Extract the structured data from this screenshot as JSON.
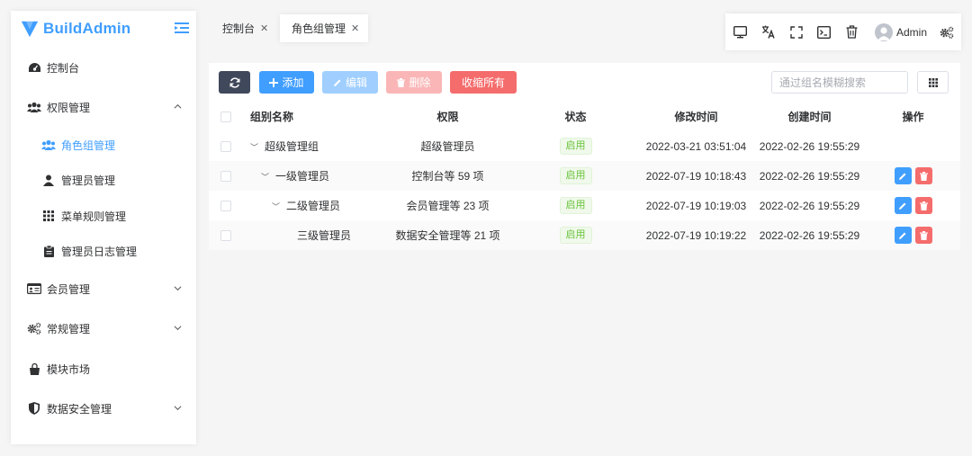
{
  "app": {
    "name": "BuildAdmin"
  },
  "sidebar": {
    "items": [
      {
        "label": "控制台"
      },
      {
        "label": "权限管理"
      },
      {
        "label": "角色组管理"
      },
      {
        "label": "管理员管理"
      },
      {
        "label": "菜单规则管理"
      },
      {
        "label": "管理员日志管理"
      },
      {
        "label": "会员管理"
      },
      {
        "label": "常规管理"
      },
      {
        "label": "模块市场"
      },
      {
        "label": "数据安全管理"
      }
    ]
  },
  "tabs": [
    {
      "label": "控制台"
    },
    {
      "label": "角色组管理"
    }
  ],
  "nav": {
    "username": "Admin"
  },
  "toolbar": {
    "add": "添加",
    "edit": "编辑",
    "delete": "删除",
    "collapse_all": "收缩所有",
    "search_placeholder": "通过组名模糊搜索"
  },
  "table": {
    "columns": [
      "组别名称",
      "权限",
      "状态",
      "修改时间",
      "创建时间",
      "操作"
    ],
    "rows": [
      {
        "name": "超级管理组",
        "rules": "超级管理员",
        "status": "启用",
        "update_time": "2022-03-21 03:51:04",
        "create_time": "2022-02-26 19:55:29"
      },
      {
        "name": "一级管理员",
        "rules": "控制台等 59 项",
        "status": "启用",
        "update_time": "2022-07-19 10:18:43",
        "create_time": "2022-02-26 19:55:29"
      },
      {
        "name": "二级管理员",
        "rules": "会员管理等 23 项",
        "status": "启用",
        "update_time": "2022-07-19 10:19:03",
        "create_time": "2022-02-26 19:55:29"
      },
      {
        "name": "三级管理员",
        "rules": "数据安全管理等 21 项",
        "status": "启用",
        "update_time": "2022-07-19 10:19:22",
        "create_time": "2022-02-26 19:55:29"
      }
    ]
  },
  "colors": {
    "primary": "#409eff",
    "danger": "#f56c6c",
    "success": "#67c23a",
    "dark": "#40485b"
  }
}
